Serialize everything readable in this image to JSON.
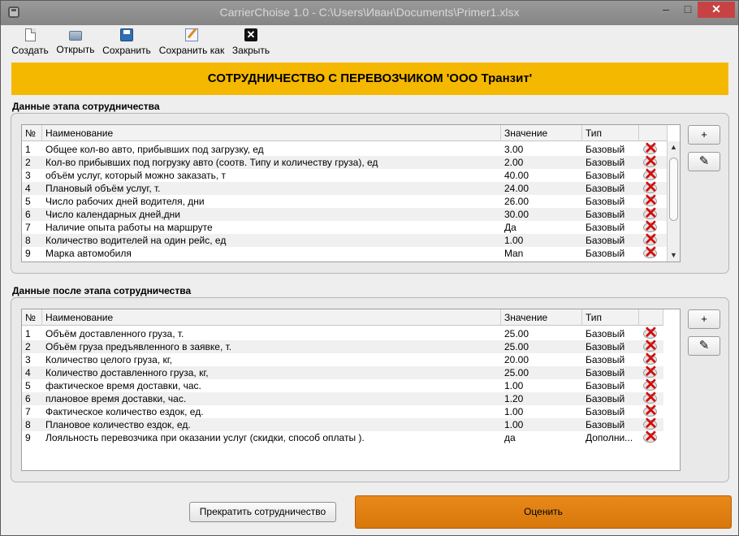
{
  "window": {
    "title": "CarrierChoise 1.0 - C:\\Users\\Иван\\Documents\\Primer1.xlsx",
    "minimize_symbol": "–",
    "maximize_symbol": "□",
    "close_symbol": "✕"
  },
  "toolbar": {
    "create_label": "Создать",
    "open_label": "Открыть",
    "save_label": "Сохранить",
    "save_as_label": "Сохранить как",
    "close_label": "Закрыть",
    "close_glyph": "✕"
  },
  "banner": {
    "text": "СОТРУДНИЧЕСТВО С ПЕРЕВОЗЧИКОМ 'ООО Транзит'",
    "color": "#f5b800"
  },
  "columns": {
    "num": "№",
    "name": "Наименование",
    "value": "Значение",
    "type": "Тип"
  },
  "section1": {
    "title": "Данные этапа сотрудничества",
    "add_label": "+",
    "edit_glyph": "✎",
    "scroll_up": "▲",
    "scroll_down": "▼",
    "rows": [
      {
        "num": "1",
        "name": "Общее кол-во авто, прибывших под загрузку, ед",
        "value": "3.00",
        "type": "Базовый"
      },
      {
        "num": "2",
        "name": "Кол-во прибывших под погрузку авто (соотв. Типу и количеству груза), ед",
        "value": "2.00",
        "type": "Базовый"
      },
      {
        "num": "3",
        "name": "объём услуг, который можно заказать, т",
        "value": "40.00",
        "type": "Базовый"
      },
      {
        "num": "4",
        "name": "Плановый объём услуг, т.",
        "value": "24.00",
        "type": "Базовый"
      },
      {
        "num": "5",
        "name": "Число рабочих дней водителя, дни",
        "value": "26.00",
        "type": "Базовый"
      },
      {
        "num": "6",
        "name": "Число календарных дней,дни",
        "value": "30.00",
        "type": "Базовый"
      },
      {
        "num": "7",
        "name": "Наличие опыта работы на маршруте",
        "value": "Да",
        "type": "Базовый"
      },
      {
        "num": "8",
        "name": "Количество водителей на один рейс, ед",
        "value": "1.00",
        "type": "Базовый"
      },
      {
        "num": "9",
        "name": "Марка автомобиля",
        "value": "Man",
        "type": "Базовый"
      }
    ]
  },
  "section2": {
    "title": "Данные после этапа сотрудничества",
    "add_label": "+",
    "edit_glyph": "✎",
    "rows": [
      {
        "num": "1",
        "name": "Объём доставленного груза, т.",
        "value": "25.00",
        "type": "Базовый"
      },
      {
        "num": "2",
        "name": "Объём груза предъявленного в заявке, т.",
        "value": "25.00",
        "type": "Базовый"
      },
      {
        "num": "3",
        "name": "Количество целого груза, кг,",
        "value": "20.00",
        "type": "Базовый"
      },
      {
        "num": "4",
        "name": "Количество доставленного груза, кг,",
        "value": "25.00",
        "type": "Базовый"
      },
      {
        "num": "5",
        "name": "фактическое время доставки, час.",
        "value": "1.00",
        "type": "Базовый"
      },
      {
        "num": "6",
        "name": "плановое время доставки, час.",
        "value": "1.20",
        "type": "Базовый"
      },
      {
        "num": "7",
        "name": "Фактическое количество ездок, ед.",
        "value": "1.00",
        "type": "Базовый"
      },
      {
        "num": "8",
        "name": "Плановое количество ездок, ед.",
        "value": "1.00",
        "type": "Базовый"
      },
      {
        "num": "9",
        "name": "Лояльность перевозчика при оказании услуг (скидки, способ оплаты ).",
        "value": "да",
        "type": "Дополни..."
      }
    ]
  },
  "footer": {
    "stop_label": "Прекратить сотрудничество",
    "evaluate_label": "Оценить",
    "evaluate_color": "#e0800f"
  },
  "icons": {
    "delete": "x-icon",
    "create": "new-file-icon",
    "open": "folder-icon",
    "save": "floppy-icon",
    "save_as": "pencil-paper-icon",
    "close": "close-icon"
  }
}
